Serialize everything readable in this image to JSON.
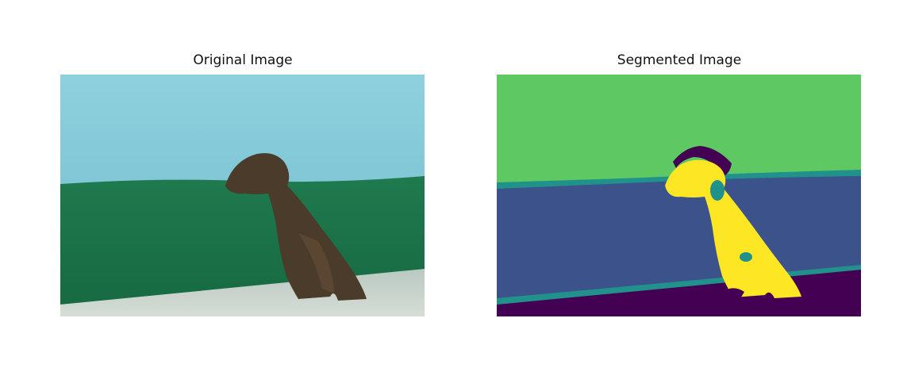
{
  "figure": {
    "left_title": "Original Image",
    "right_title": "Segmented Image"
  },
  "colors": {
    "viridis_purple": "#440154",
    "viridis_blue": "#3b528b",
    "viridis_teal": "#21918c",
    "viridis_green": "#5ec962",
    "viridis_yellow": "#fde725"
  }
}
